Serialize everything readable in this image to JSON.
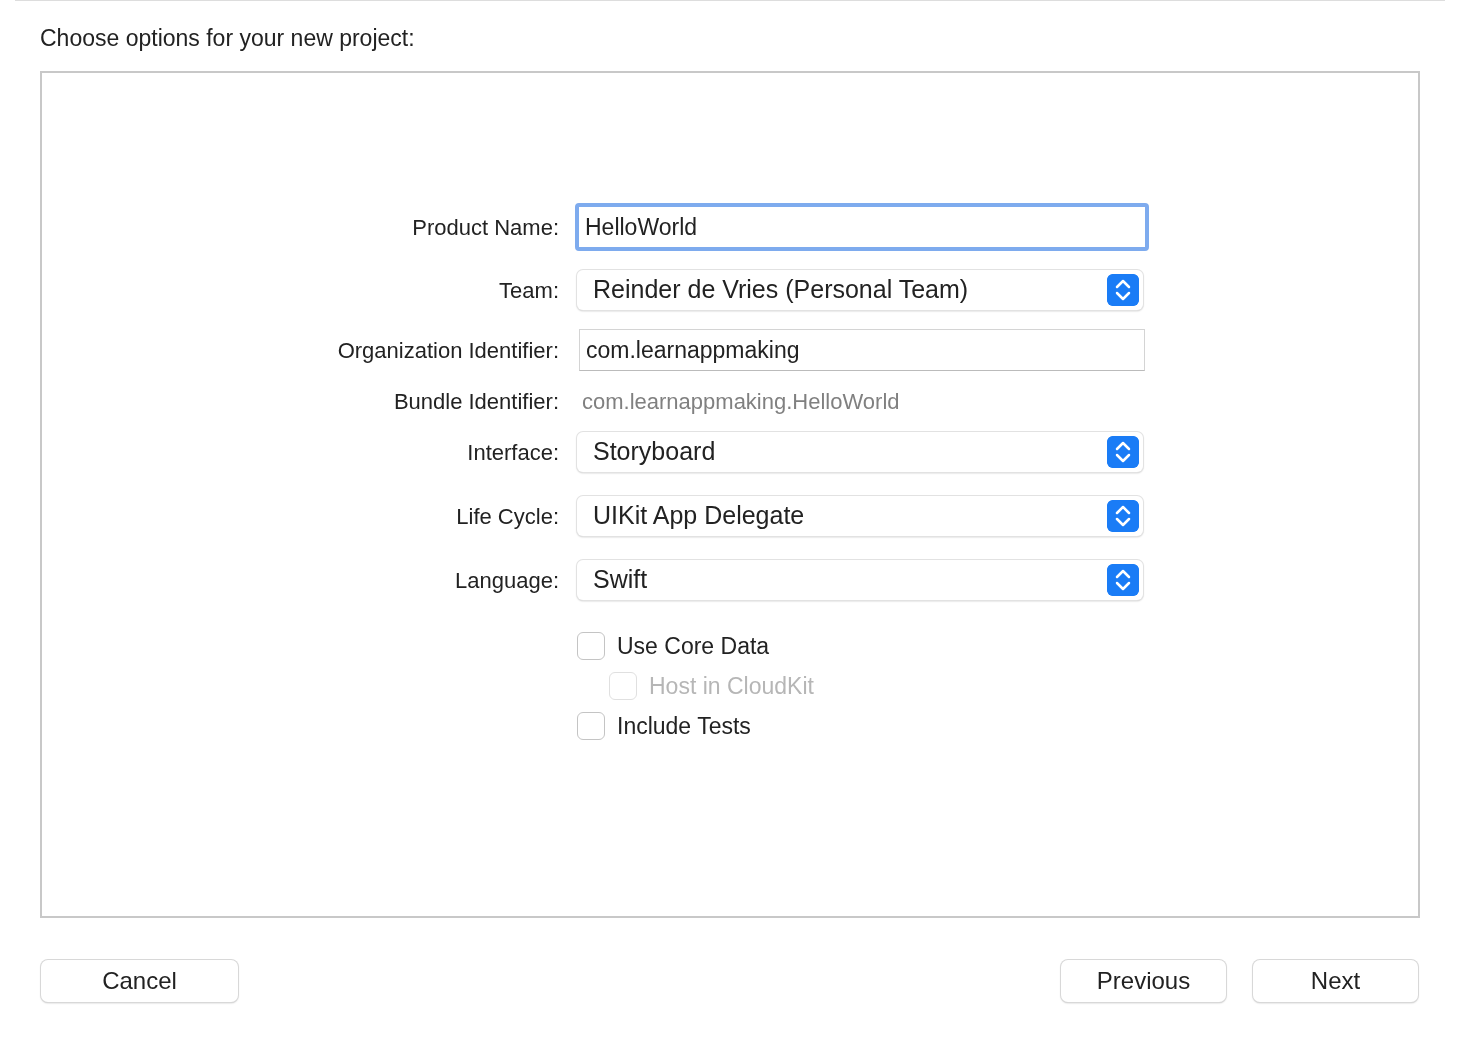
{
  "heading": "Choose options for your new project:",
  "fields": [
    {
      "kind": "text",
      "label": "Product Name:",
      "value": "HelloWorld",
      "focused": true
    },
    {
      "kind": "popup",
      "label": "Team:",
      "value": "Reinder de Vries (Personal Team)"
    },
    {
      "kind": "text",
      "label": "Organization Identifier:",
      "value": "com.learnappmaking",
      "focused": false
    },
    {
      "kind": "static",
      "label": "Bundle Identifier:",
      "value": "com.learnappmaking.HelloWorld"
    },
    {
      "kind": "popup",
      "label": "Interface:",
      "value": "Storyboard"
    },
    {
      "kind": "popup",
      "label": "Life Cycle:",
      "value": "UIKit App Delegate"
    },
    {
      "kind": "popup",
      "label": "Language:",
      "value": "Swift"
    }
  ],
  "options": [
    {
      "label": "Use Core Data",
      "checked": false,
      "disabled": false,
      "children": [
        {
          "label": "Host in CloudKit",
          "checked": false,
          "disabled": true
        }
      ]
    },
    {
      "label": "Include Tests",
      "checked": false,
      "disabled": false
    }
  ],
  "buttons": {
    "left": [
      "Cancel"
    ],
    "right": [
      "Previous",
      "Next"
    ]
  }
}
